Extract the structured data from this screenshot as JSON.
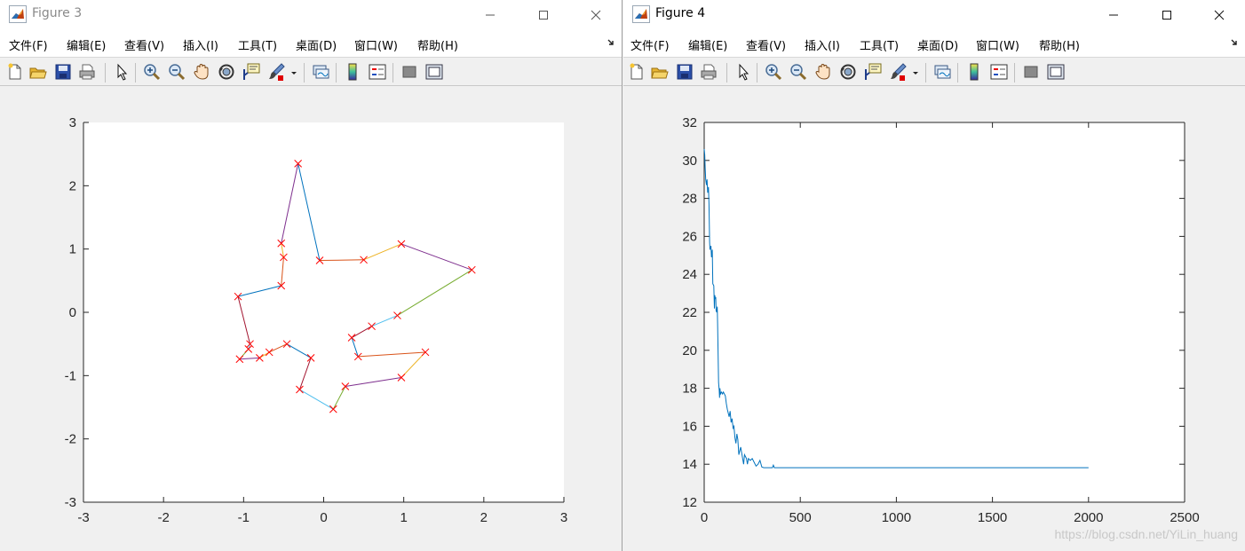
{
  "windows": [
    {
      "title": "Figure 3",
      "active": false,
      "menus": [
        "文件(F)",
        "编辑(E)",
        "查看(V)",
        "插入(I)",
        "工具(T)",
        "桌面(D)",
        "窗口(W)",
        "帮助(H)"
      ]
    },
    {
      "title": "Figure 4",
      "active": true,
      "menus": [
        "文件(F)",
        "编辑(E)",
        "查看(V)",
        "插入(I)",
        "工具(T)",
        "桌面(D)",
        "窗口(W)",
        "帮助(H)"
      ]
    }
  ],
  "toolbar_icons": [
    "new-figure-icon",
    "open-file-icon",
    "save-icon",
    "print-icon",
    "edit-plot-arrow-icon",
    "zoom-in-icon",
    "zoom-out-icon",
    "pan-hand-icon",
    "rotate-3d-icon",
    "data-cursor-icon",
    "brush-icon",
    "link-plot-icon",
    "insert-colorbar-icon",
    "insert-legend-icon",
    "hide-plot-tools-icon",
    "show-plot-tools-icon"
  ],
  "colors": {
    "route_segments": [
      "#0072bd",
      "#d95319",
      "#edb120",
      "#7e2f8e",
      "#77ac30",
      "#4dbeee",
      "#a2142f"
    ],
    "city_marker": "#ff0000",
    "convergence_line": "#0072bd"
  },
  "watermark": "https://blog.csdn.net/YiLin_huang",
  "chart_data": [
    {
      "type": "scatter",
      "title": "",
      "xlabel": "",
      "ylabel": "",
      "xlim": [
        -3,
        3
      ],
      "ylim": [
        -3,
        3
      ],
      "xticks": [
        "-3",
        "-2",
        "-1",
        "0",
        "1",
        "2",
        "3"
      ],
      "yticks": [
        "-3",
        "-2",
        "-1",
        "0",
        "1",
        "2",
        "3"
      ],
      "grid": false,
      "marker": "x",
      "closed_route": true,
      "points": [
        [
          -0.32,
          2.35
        ],
        [
          -0.05,
          0.82
        ],
        [
          0.5,
          0.83
        ],
        [
          0.97,
          1.08
        ],
        [
          1.85,
          0.67
        ],
        [
          0.92,
          -0.05
        ],
        [
          0.6,
          -0.22
        ],
        [
          0.35,
          -0.4
        ],
        [
          0.43,
          -0.7
        ],
        [
          1.27,
          -0.63
        ],
        [
          0.97,
          -1.03
        ],
        [
          0.27,
          -1.17
        ],
        [
          0.12,
          -1.53
        ],
        [
          -0.3,
          -1.22
        ],
        [
          -0.16,
          -0.72
        ],
        [
          -0.46,
          -0.5
        ],
        [
          -0.68,
          -0.63
        ],
        [
          -0.8,
          -0.72
        ],
        [
          -1.05,
          -0.74
        ],
        [
          -0.94,
          -0.58
        ],
        [
          -0.92,
          -0.5
        ],
        [
          -1.07,
          0.25
        ],
        [
          -0.53,
          0.42
        ],
        [
          -0.5,
          0.87
        ],
        [
          -0.53,
          1.09
        ]
      ]
    },
    {
      "type": "line",
      "title": "",
      "xlabel": "",
      "ylabel": "",
      "xlim": [
        0,
        2500
      ],
      "ylim": [
        12,
        32
      ],
      "xticks": [
        "0",
        "500",
        "1000",
        "1500",
        "2000",
        "2500"
      ],
      "yticks": [
        "12",
        "14",
        "16",
        "18",
        "20",
        "22",
        "24",
        "26",
        "28",
        "30",
        "32"
      ],
      "grid": false,
      "series": [
        {
          "x": [
            0,
            3,
            5,
            8,
            12,
            15,
            18,
            22,
            25,
            28,
            30,
            35,
            38,
            42,
            45,
            50,
            53,
            55,
            58,
            60,
            62,
            65,
            68,
            70,
            72,
            75,
            78,
            80,
            82,
            85,
            90,
            95,
            100,
            110,
            115,
            120,
            130,
            135,
            140,
            145,
            150,
            155,
            160,
            165,
            170,
            175,
            180,
            185,
            190,
            195,
            200,
            205,
            210,
            215,
            220,
            225,
            230,
            240,
            250,
            260,
            270,
            280,
            290,
            300,
            310,
            320,
            330,
            340,
            350,
            355,
            360,
            365,
            370,
            380,
            2000
          ],
          "y": [
            30.6,
            30.3,
            29.6,
            29.0,
            28.7,
            29.0,
            28.3,
            28.6,
            27.7,
            25.7,
            25.3,
            25.5,
            24.9,
            25.3,
            23.5,
            23.4,
            22.2,
            22.9,
            22.7,
            22.8,
            22.1,
            22.0,
            22.3,
            21.4,
            20.0,
            18.3,
            17.9,
            17.5,
            18.0,
            17.7,
            17.8,
            17.7,
            17.8,
            17.6,
            17.2,
            16.9,
            16.5,
            16.8,
            16.2,
            16.4,
            15.9,
            16.0,
            15.4,
            15.1,
            15.6,
            15.3,
            14.5,
            14.7,
            14.9,
            14.6,
            14.3,
            14.0,
            14.5,
            14.4,
            14.3,
            14.0,
            14.3,
            14.2,
            14.3,
            14.1,
            13.9,
            14.0,
            14.2,
            13.85,
            13.82,
            13.82,
            13.82,
            13.82,
            13.82,
            13.82,
            13.95,
            13.82,
            13.82,
            13.82,
            13.82
          ]
        }
      ]
    }
  ]
}
